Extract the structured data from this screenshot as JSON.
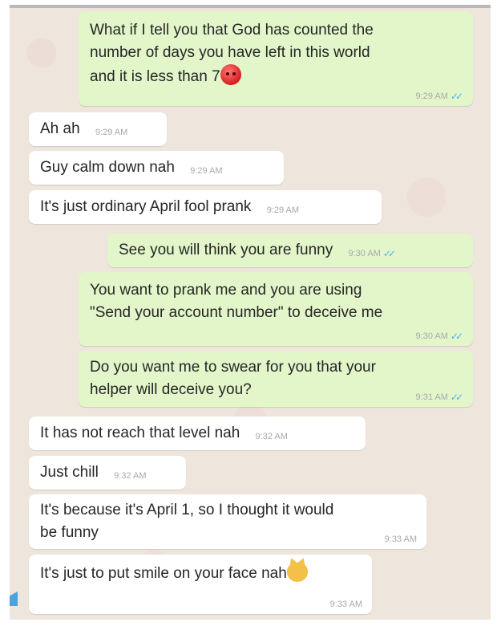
{
  "messages": [
    {
      "id": "m1",
      "side": "out",
      "text": "What if I tell you that God has counted the\nnumber of days you have left in this world\nand it is less than 7",
      "emoji": "angry-face",
      "time": "9:29 AM",
      "status": "read"
    },
    {
      "id": "m2",
      "side": "in",
      "text": "Ah ah",
      "time": "9:29 AM"
    },
    {
      "id": "m3",
      "side": "in",
      "text": "Guy calm down nah",
      "time": "9:29 AM"
    },
    {
      "id": "m4",
      "side": "in",
      "text": "It's just ordinary April fool prank",
      "time": "9:29 AM"
    },
    {
      "id": "m5",
      "side": "out",
      "text": "See you will think you are funny",
      "time": "9:30 AM",
      "status": "read"
    },
    {
      "id": "m6",
      "side": "out",
      "text": "You want to prank me and you are using\n\"Send your account number\" to deceive me",
      "time": "9:30 AM",
      "status": "read"
    },
    {
      "id": "m7",
      "side": "out",
      "text": "Do you want me to swear for you that your\nhelper will deceive you?",
      "time": "9:31 AM",
      "status": "read"
    },
    {
      "id": "m8",
      "side": "in",
      "text": "It has not reach that level nah",
      "time": "9:32 AM"
    },
    {
      "id": "m9",
      "side": "in",
      "text": "Just chill",
      "time": "9:32 AM"
    },
    {
      "id": "m10",
      "side": "in",
      "text": "It's because it's April 1, so I thought it would\nbe funny",
      "time": "9:33 AM"
    },
    {
      "id": "m11",
      "side": "in",
      "text": "It's just to put smile on your face nah",
      "emoji": "grinning-cat",
      "time": "9:33 AM"
    }
  ],
  "read_tick_glyph": "✓✓",
  "colors": {
    "outgoing_bubble": "#e2f6ca",
    "incoming_bubble": "#ffffff",
    "chat_background": "#eee6dc",
    "read_ticks": "#4fb3e6",
    "timestamp": "#a9a9a9"
  }
}
